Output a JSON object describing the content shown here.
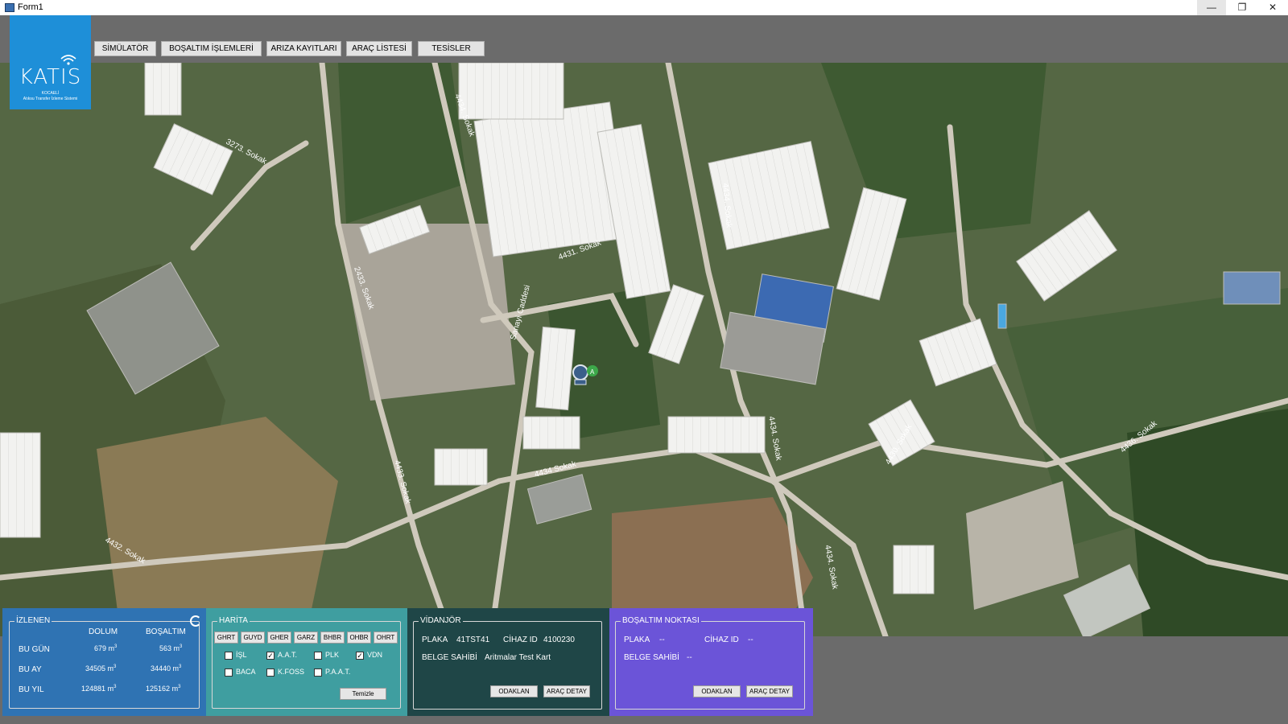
{
  "window": {
    "title": "Form1",
    "minimize": "—",
    "maximize": "❐",
    "close": "✕"
  },
  "logo": {
    "brand": "KATIS",
    "line1": "KOCAELİ",
    "line2": "Atıksu Transfer İzleme Sistemi"
  },
  "nav": [
    "SİMÜLATÖR",
    "BOŞALTIM İŞLEMLERİ",
    "ARIZA KAYITLARI",
    "ARAÇ LİSTESİ",
    "TESİSLER"
  ],
  "map": {
    "streets": [
      "3273. Sokak",
      "4434. Sokak",
      "4431. Sokak",
      "2433. Sokak",
      "Sanayi Caddesi",
      "4434 Sokak",
      "4433. Sokak",
      "4432. Sokak",
      "4434. Sokak",
      "4436. Sokak",
      "4430. Sokak",
      "4434. Sokak",
      "4434. Sokak"
    ],
    "marker_badge": "A"
  },
  "izlenen": {
    "title": "İZLENEN",
    "col_fill": "DOLUM",
    "col_empty": "BOŞALTIM",
    "unit": "m",
    "unit_exp": "3",
    "rows": [
      {
        "label": "BU GÜN",
        "fill": "679",
        "empty": "563"
      },
      {
        "label": "BU AY",
        "fill": "34505",
        "empty": "34440"
      },
      {
        "label": "BU YIL",
        "fill": "124881",
        "empty": "125162"
      }
    ]
  },
  "harita": {
    "title": "HARİTA",
    "buttons": [
      "GHRT",
      "GUYD",
      "GHER",
      "GARZ",
      "BHBR",
      "OHBR",
      "OHRT"
    ],
    "checks": [
      {
        "label": "İŞL",
        "checked": false
      },
      {
        "label": "A.A.T.",
        "checked": true
      },
      {
        "label": "PLK",
        "checked": false
      },
      {
        "label": "VDN",
        "checked": true
      },
      {
        "label": "BACA",
        "checked": false
      },
      {
        "label": "K.FOSS",
        "checked": false
      },
      {
        "label": "P.A.A.T.",
        "checked": false
      }
    ],
    "clear_label": "Temizle"
  },
  "vidanjor": {
    "title": "VİDANJÖR",
    "plate_label": "PLAKA",
    "plate": "41TST41",
    "device_label": "CİHAZ ID",
    "device": "4100230",
    "owner_label": "BELGE SAHİBİ",
    "owner": "Aritmalar Test Kart",
    "focus_label": "ODAKLAN",
    "detail_label": "ARAÇ DETAY"
  },
  "bosaltim": {
    "title": "BOŞALTIM NOKTASI",
    "plate_label": "PLAKA",
    "plate": "--",
    "device_label": "CİHAZ ID",
    "device": "--",
    "owner_label": "BELGE SAHİBİ",
    "owner": "--",
    "focus_label": "ODAKLAN",
    "detail_label": "ARAÇ DETAY"
  },
  "colors": {
    "izlenen": "#2f73b3",
    "harita": "#3f9ea0",
    "vidanjor": "#1f4647",
    "bosaltim": "#6b54d8",
    "logo": "#1e8fd8"
  }
}
